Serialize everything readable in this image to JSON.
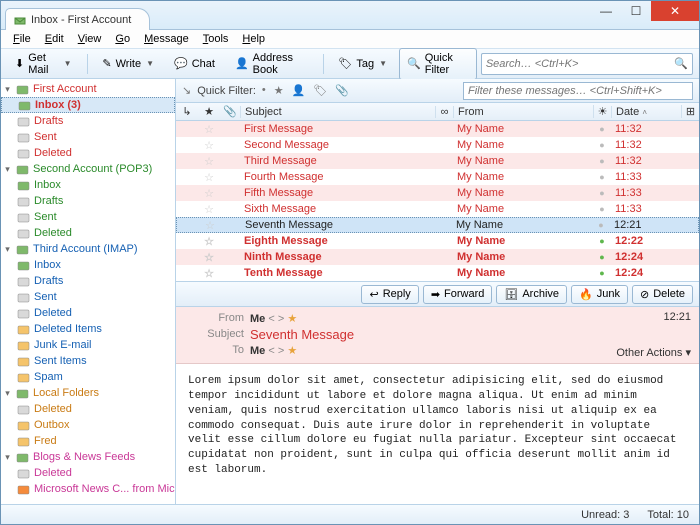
{
  "window_title": "Inbox - First Account",
  "menus": {
    "file": "File",
    "edit": "Edit",
    "view": "View",
    "go": "Go",
    "message": "Message",
    "tools": "Tools",
    "help": "Help"
  },
  "toolbar": {
    "get_mail": "Get Mail",
    "write": "Write",
    "chat": "Chat",
    "address_book": "Address Book",
    "tag": "Tag",
    "quick_filter": "Quick Filter",
    "search_placeholder": "Search… <Ctrl+K>"
  },
  "sidebar": {
    "accounts": [
      {
        "name": "First Account",
        "color": "c-red",
        "folders": [
          {
            "name": "Inbox (3)",
            "icon": "inbox",
            "sel": true
          },
          {
            "name": "Drafts",
            "icon": "drafts"
          },
          {
            "name": "Sent",
            "icon": "sent"
          },
          {
            "name": "Deleted",
            "icon": "trash"
          }
        ]
      },
      {
        "name": "Second Account (POP3)",
        "color": "c-green",
        "folders": [
          {
            "name": "Inbox",
            "icon": "inbox"
          },
          {
            "name": "Drafts",
            "icon": "drafts"
          },
          {
            "name": "Sent",
            "icon": "sent"
          },
          {
            "name": "Deleted",
            "icon": "trash"
          }
        ]
      },
      {
        "name": "Third Account (IMAP)",
        "color": "c-blue",
        "folders": [
          {
            "name": "Inbox",
            "icon": "inbox"
          },
          {
            "name": "Drafts",
            "icon": "drafts"
          },
          {
            "name": "Sent",
            "icon": "sent"
          },
          {
            "name": "Deleted",
            "icon": "trash"
          },
          {
            "name": "Deleted Items",
            "icon": "folder"
          },
          {
            "name": "Junk E-mail",
            "icon": "folder"
          },
          {
            "name": "Sent Items",
            "icon": "folder"
          },
          {
            "name": "Spam",
            "icon": "folder"
          }
        ]
      },
      {
        "name": "Local Folders",
        "color": "c-orange",
        "folders": [
          {
            "name": "Deleted",
            "icon": "trash"
          },
          {
            "name": "Outbox",
            "icon": "outbox"
          },
          {
            "name": "Fred",
            "icon": "folder"
          }
        ]
      },
      {
        "name": "Blogs & News Feeds",
        "color": "c-magenta",
        "folders": [
          {
            "name": "Deleted",
            "icon": "trash"
          },
          {
            "name": "Microsoft News C... from Microsoft",
            "icon": "rss"
          }
        ]
      }
    ]
  },
  "quickfilter": {
    "label": "Quick Filter:",
    "placeholder": "Filter these messages… <Ctrl+Shift+K>"
  },
  "columns": {
    "subject": "Subject",
    "from": "From",
    "date": "Date"
  },
  "messages": [
    {
      "subject": "First Message",
      "from": "My Name",
      "date": "11:32",
      "unread": false,
      "dot": "gray"
    },
    {
      "subject": "Second Message",
      "from": "My Name",
      "date": "11:32",
      "unread": false,
      "dot": "gray"
    },
    {
      "subject": "Third Message",
      "from": "My Name",
      "date": "11:32",
      "unread": false,
      "dot": "gray"
    },
    {
      "subject": "Fourth Message",
      "from": "My Name",
      "date": "11:33",
      "unread": false,
      "dot": "gray"
    },
    {
      "subject": "Fifth Message",
      "from": "My Name",
      "date": "11:33",
      "unread": false,
      "dot": "gray"
    },
    {
      "subject": "Sixth Message",
      "from": "My Name",
      "date": "11:33",
      "unread": false,
      "dot": "gray"
    },
    {
      "subject": "Seventh Message",
      "from": "My Name",
      "date": "12:21",
      "unread": false,
      "dot": "gray",
      "sel": true
    },
    {
      "subject": "Eighth Message",
      "from": "My Name",
      "date": "12:22",
      "unread": true,
      "dot": "green"
    },
    {
      "subject": "Ninth Message",
      "from": "My Name",
      "date": "12:24",
      "unread": true,
      "dot": "green"
    },
    {
      "subject": "Tenth Message",
      "from": "My Name",
      "date": "12:24",
      "unread": true,
      "dot": "green"
    }
  ],
  "actions": {
    "reply": "Reply",
    "forward": "Forward",
    "archive": "Archive",
    "junk": "Junk",
    "delete": "Delete"
  },
  "preview": {
    "from_label": "From",
    "subject_label": "Subject",
    "to_label": "To",
    "from_name": "Me",
    "from_addr": "<                               >",
    "subject": "Seventh Message",
    "to_name": "Me",
    "to_addr": "<                               >",
    "time": "12:21",
    "other_actions": "Other Actions ▾",
    "body": "Lorem ipsum dolor sit amet, consectetur adipisicing elit, sed do eiusmod tempor incididunt ut labore et dolore magna aliqua. Ut enim ad minim veniam, quis nostrud exercitation ullamco laboris nisi ut aliquip ex ea commodo consequat. Duis aute irure dolor in reprehenderit in voluptate velit esse cillum dolore eu fugiat nulla pariatur. Excepteur sint occaecat cupidatat non proident, sunt in culpa qui officia deserunt mollit anim id est laborum."
  },
  "status": {
    "unread": "Unread: 3",
    "total": "Total: 10"
  }
}
